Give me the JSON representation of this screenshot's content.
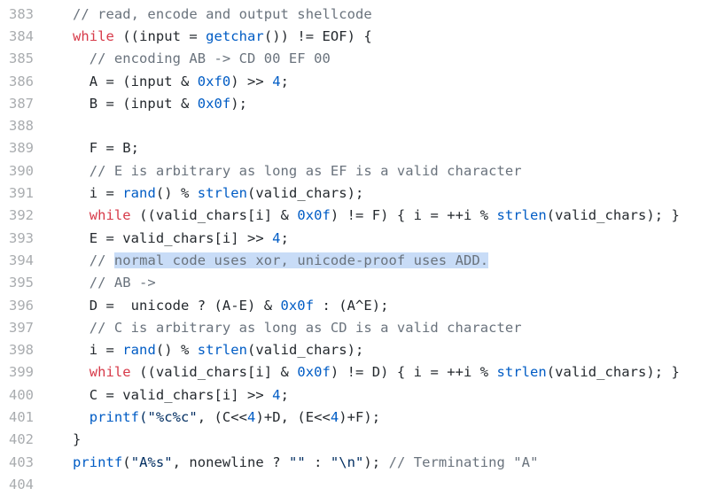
{
  "code": {
    "lines": [
      {
        "number": "383",
        "tokens": [
          {
            "text": "// read, encode and output shellcode",
            "kind": "comment"
          }
        ]
      },
      {
        "number": "384",
        "tokens": [
          {
            "text": "while",
            "kind": "keyword"
          },
          {
            "text": " ((input = ",
            "kind": "plain"
          },
          {
            "text": "getchar",
            "kind": "func"
          },
          {
            "text": "()) != EOF) {",
            "kind": "plain"
          }
        ]
      },
      {
        "number": "385",
        "tokens": [
          {
            "text": "  // encoding AB -> CD 00 EF 00",
            "kind": "comment"
          }
        ]
      },
      {
        "number": "386",
        "tokens": [
          {
            "text": "  A = (input & ",
            "kind": "plain"
          },
          {
            "text": "0xf0",
            "kind": "num"
          },
          {
            "text": ") >> ",
            "kind": "plain"
          },
          {
            "text": "4",
            "kind": "num"
          },
          {
            "text": ";",
            "kind": "plain"
          }
        ]
      },
      {
        "number": "387",
        "tokens": [
          {
            "text": "  B = (input & ",
            "kind": "plain"
          },
          {
            "text": "0x0f",
            "kind": "num"
          },
          {
            "text": ");",
            "kind": "plain"
          }
        ]
      },
      {
        "number": "388",
        "tokens": []
      },
      {
        "number": "389",
        "tokens": [
          {
            "text": "  F = B;",
            "kind": "plain"
          }
        ]
      },
      {
        "number": "390",
        "tokens": [
          {
            "text": "  // E is arbitrary as long as EF is a valid character",
            "kind": "comment"
          }
        ]
      },
      {
        "number": "391",
        "tokens": [
          {
            "text": "  i = ",
            "kind": "plain"
          },
          {
            "text": "rand",
            "kind": "func"
          },
          {
            "text": "() % ",
            "kind": "plain"
          },
          {
            "text": "strlen",
            "kind": "func"
          },
          {
            "text": "(valid_chars);",
            "kind": "plain"
          }
        ]
      },
      {
        "number": "392",
        "tokens": [
          {
            "text": "  ",
            "kind": "plain"
          },
          {
            "text": "while",
            "kind": "keyword"
          },
          {
            "text": " ((valid_chars[i] & ",
            "kind": "plain"
          },
          {
            "text": "0x0f",
            "kind": "num"
          },
          {
            "text": ") != F) { i = ++i % ",
            "kind": "plain"
          },
          {
            "text": "strlen",
            "kind": "func"
          },
          {
            "text": "(valid_chars); }",
            "kind": "plain"
          }
        ]
      },
      {
        "number": "393",
        "tokens": [
          {
            "text": "  E = valid_chars[i] >> ",
            "kind": "plain"
          },
          {
            "text": "4",
            "kind": "num"
          },
          {
            "text": ";",
            "kind": "plain"
          }
        ]
      },
      {
        "number": "394",
        "tokens": [
          {
            "text": "  // ",
            "kind": "comment"
          },
          {
            "text": "normal code uses xor, unicode-proof uses ADD.",
            "kind": "comment",
            "selected": true
          }
        ]
      },
      {
        "number": "395",
        "tokens": [
          {
            "text": "  // AB ->",
            "kind": "comment"
          }
        ]
      },
      {
        "number": "396",
        "tokens": [
          {
            "text": "  D =  unicode ? (A-E) & ",
            "kind": "plain"
          },
          {
            "text": "0x0f",
            "kind": "num"
          },
          {
            "text": " : (A^E);",
            "kind": "plain"
          }
        ]
      },
      {
        "number": "397",
        "tokens": [
          {
            "text": "  // C is arbitrary as long as CD is a valid character",
            "kind": "comment"
          }
        ]
      },
      {
        "number": "398",
        "tokens": [
          {
            "text": "  i = ",
            "kind": "plain"
          },
          {
            "text": "rand",
            "kind": "func"
          },
          {
            "text": "() % ",
            "kind": "plain"
          },
          {
            "text": "strlen",
            "kind": "func"
          },
          {
            "text": "(valid_chars);",
            "kind": "plain"
          }
        ]
      },
      {
        "number": "399",
        "tokens": [
          {
            "text": "  ",
            "kind": "plain"
          },
          {
            "text": "while",
            "kind": "keyword"
          },
          {
            "text": " ((valid_chars[i] & ",
            "kind": "plain"
          },
          {
            "text": "0x0f",
            "kind": "num"
          },
          {
            "text": ") != D) { i = ++i % ",
            "kind": "plain"
          },
          {
            "text": "strlen",
            "kind": "func"
          },
          {
            "text": "(valid_chars); }",
            "kind": "plain"
          }
        ]
      },
      {
        "number": "400",
        "tokens": [
          {
            "text": "  C = valid_chars[i] >> ",
            "kind": "plain"
          },
          {
            "text": "4",
            "kind": "num"
          },
          {
            "text": ";",
            "kind": "plain"
          }
        ]
      },
      {
        "number": "401",
        "tokens": [
          {
            "text": "  ",
            "kind": "plain"
          },
          {
            "text": "printf",
            "kind": "func"
          },
          {
            "text": "(\"%c%c\"",
            "kind": "string"
          },
          {
            "text": ", (C<<",
            "kind": "plain"
          },
          {
            "text": "4",
            "kind": "num"
          },
          {
            "text": ")+D, (E<<",
            "kind": "plain"
          },
          {
            "text": "4",
            "kind": "num"
          },
          {
            "text": ")+F);",
            "kind": "plain"
          }
        ]
      },
      {
        "number": "402",
        "tokens": [
          {
            "text": "}",
            "kind": "plain"
          }
        ]
      },
      {
        "number": "403",
        "tokens": [
          {
            "text": "printf",
            "kind": "func"
          },
          {
            "text": "(",
            "kind": "plain"
          },
          {
            "text": "\"A%s\"",
            "kind": "string"
          },
          {
            "text": ", nonewline ? ",
            "kind": "plain"
          },
          {
            "text": "\"\"",
            "kind": "string"
          },
          {
            "text": " : ",
            "kind": "plain"
          },
          {
            "text": "\"\\n\"",
            "kind": "string"
          },
          {
            "text": "); ",
            "kind": "plain"
          },
          {
            "text": "// Terminating \"A\"",
            "kind": "comment"
          }
        ]
      },
      {
        "number": "404",
        "tokens": []
      }
    ]
  },
  "theme": {
    "comment": "#6a737d",
    "keyword": "#d73a49",
    "func": "#005cc5",
    "num": "#005cc5",
    "string": "#032f62",
    "plain": "#24292e",
    "line_number": "#a9acaf",
    "selection": "#c8dcf7"
  }
}
